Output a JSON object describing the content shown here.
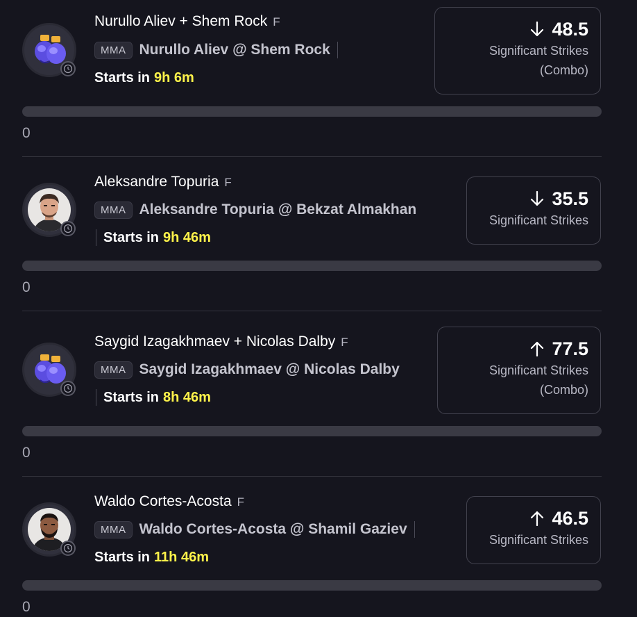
{
  "colors": {
    "background": "#15151e",
    "accent_time": "#fff34a",
    "track": "#3a3a44"
  },
  "cards": [
    {
      "title": "Nurullo Aliev + Shem Rock",
      "tag": "F",
      "league": "MMA",
      "matchup": "Nurullo Aliev @ Shem Rock",
      "starts_label": "Starts in",
      "starts_time": "9h 6m",
      "direction_icon": "arrow-down-icon",
      "value": "48.5",
      "stat_line1": "Significant Strikes",
      "stat_line2": "(Combo)",
      "count": "0",
      "avatar": "boxing-gloves-icon"
    },
    {
      "title": "Aleksandre Topuria",
      "tag": "F",
      "league": "MMA",
      "matchup": "Aleksandre Topuria @ Bekzat Almakhan",
      "starts_label": "Starts in",
      "starts_time": "9h 46m",
      "direction_icon": "arrow-down-icon",
      "value": "35.5",
      "stat_line1": "Significant Strikes",
      "count": "0",
      "avatar": "fighter-photo"
    },
    {
      "title": "Saygid Izagakhmaev + Nicolas Dalby",
      "tag": "F",
      "league": "MMA",
      "matchup": "Saygid Izagakhmaev @ Nicolas Dalby",
      "starts_label": "Starts in",
      "starts_time": "8h 46m",
      "direction_icon": "arrow-up-icon",
      "value": "77.5",
      "stat_line1": "Significant Strikes",
      "stat_line2": "(Combo)",
      "count": "0",
      "avatar": "boxing-gloves-icon"
    },
    {
      "title": "Waldo Cortes-Acosta",
      "tag": "F",
      "league": "MMA",
      "matchup": "Waldo Cortes-Acosta @ Shamil Gaziev",
      "starts_label": "Starts in",
      "starts_time": "11h 46m",
      "direction_icon": "arrow-up-icon",
      "value": "46.5",
      "stat_line1": "Significant Strikes",
      "count": "0",
      "avatar": "fighter-photo"
    }
  ]
}
